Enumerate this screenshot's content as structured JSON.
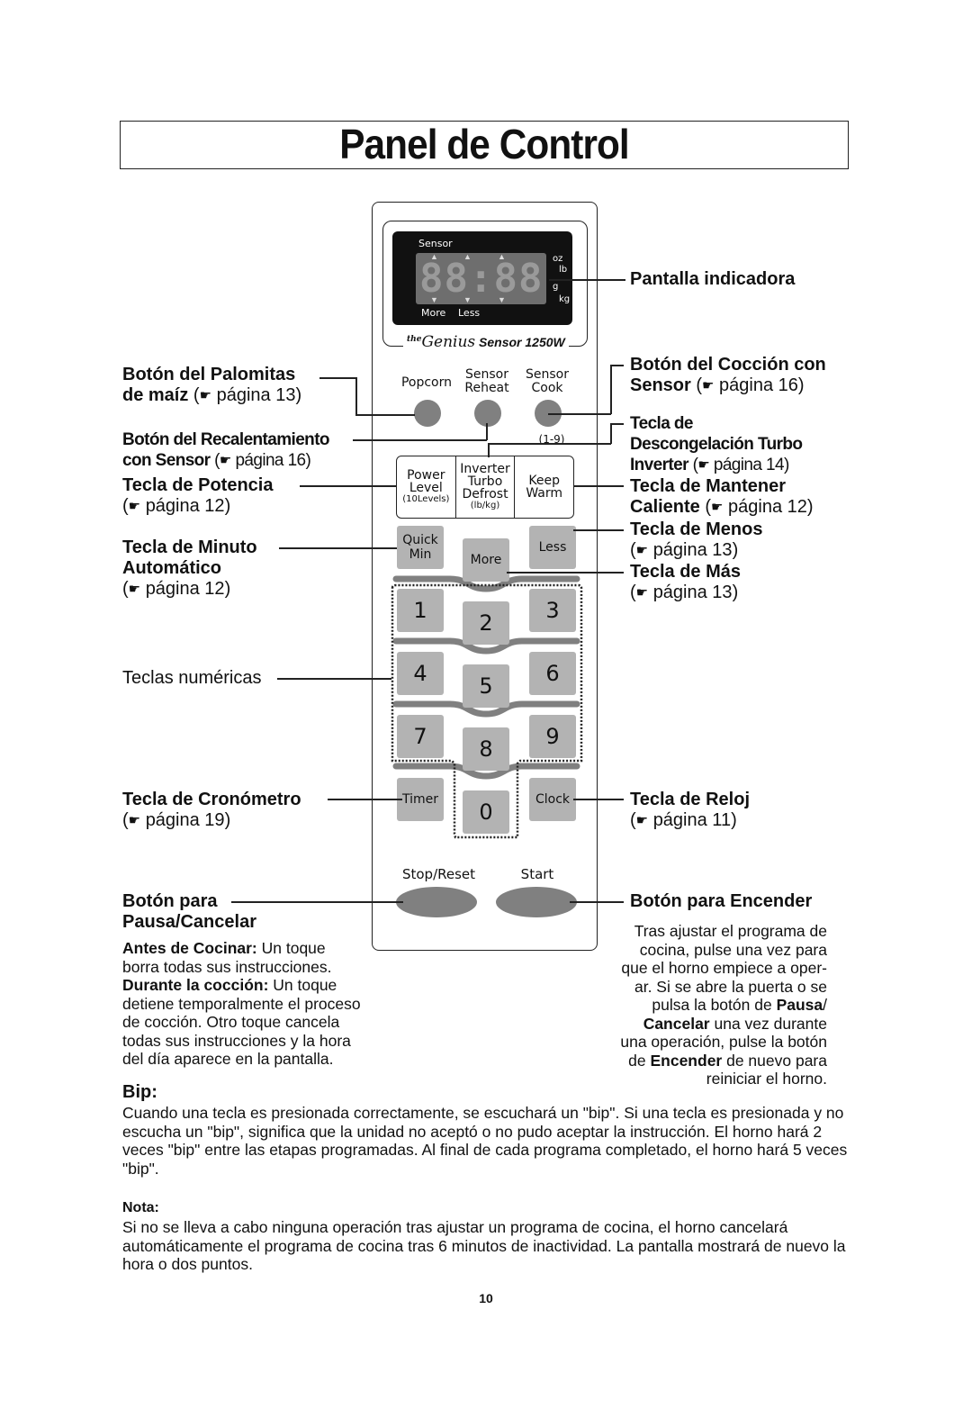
{
  "page": {
    "title": "Panel de Control",
    "page_number": "10",
    "page_ref_icon": "pointing-hand-icon",
    "page_ref_glyph": "☛"
  },
  "panel": {
    "display": {
      "sensor_label": "Sensor",
      "digits": "88:88",
      "more_label": "More",
      "less_label": "Less",
      "unit_oz_lb_top": "oz",
      "unit_oz_lb_bottom": "lb",
      "unit_g_kg_top": "g",
      "unit_g_kg_bottom": "kg"
    },
    "brand": {
      "the": "the",
      "genius": "Genius",
      "model": "Sensor 1250W"
    },
    "top_buttons": [
      {
        "label_line1": "",
        "label_line2": "Popcorn"
      },
      {
        "label_line1": "Sensor",
        "label_line2": "Reheat"
      },
      {
        "label_line1": "Sensor",
        "label_line2": "Cook"
      }
    ],
    "sensor_cook_range": "(1-9)",
    "function_bar": [
      {
        "lines": [
          "Power",
          "Level"
        ],
        "sub": "(10Levels)"
      },
      {
        "lines": [
          "Inverter",
          "Turbo",
          "Defrost"
        ],
        "sub": "(lb/kg)"
      },
      {
        "lines": [
          "Keep",
          "Warm"
        ],
        "sub": ""
      }
    ],
    "quick_min": [
      "Quick",
      "Min"
    ],
    "more": "More",
    "less": "Less",
    "numbers": [
      "1",
      "2",
      "3",
      "4",
      "5",
      "6",
      "7",
      "8",
      "9",
      "0"
    ],
    "timer": "Timer",
    "clock": "Clock",
    "stop_reset": "Stop/Reset",
    "start": "Start",
    "colors": {
      "display_bg": "#111111",
      "display_inner": "#6e6e6e",
      "key_fill": "#b3b3b3",
      "button_fill": "#808080",
      "wave": "#808080"
    }
  },
  "callouts_left": {
    "popcorn": {
      "bold": "Botón del Palomitas",
      "bold2": "de maíz",
      "ref": "página 13"
    },
    "reheat": {
      "bold": "Botón del Recalentamiento",
      "bold2": "con Sensor",
      "ref": "página 16"
    },
    "power": {
      "bold": "Tecla de Potencia",
      "ref": "página 12"
    },
    "quick_min": {
      "bold": "Tecla de Minuto",
      "bold2": "Automático",
      "ref": "página 12"
    },
    "numeric": {
      "text": "Teclas numéricas"
    },
    "timer": {
      "bold": "Tecla de Cronómetro",
      "ref": "página 19"
    },
    "stop": {
      "bold": "Botón para",
      "bold2": "Pausa/Cancelar"
    }
  },
  "callouts_right": {
    "display": {
      "bold": "Pantalla indicadora"
    },
    "sensor_cook": {
      "bold": "Botón del Cocción con",
      "bold2": "Sensor",
      "ref": "página 16"
    },
    "defrost": {
      "bold": "Tecla de",
      "bold2": "Descongelación Turbo",
      "bold3": "Inverter",
      "ref": "página 14"
    },
    "keep_warm": {
      "bold": "Tecla de Mantener",
      "bold2": "Caliente",
      "ref": "página 12"
    },
    "less": {
      "bold": "Tecla de Menos",
      "ref": "página 13"
    },
    "more": {
      "bold": "Tecla de Más",
      "ref": "página 13"
    },
    "clock": {
      "bold": "Tecla de Reloj",
      "ref": "página 11"
    },
    "start": {
      "bold": "Botón para Encender"
    }
  },
  "stop_description": {
    "before_bold": "Antes de Cocinar:",
    "before_text": " Un toque",
    "line2": "borra todas sus instrucciones.",
    "during_bold": "Durante la cocción:",
    "during_text": " Un toque",
    "line4": "detiene temporalmente el proceso",
    "line5": "de cocción. Otro toque cancela",
    "line6": "todas sus instrucciones y la hora",
    "line7": "del día aparece en la pantalla."
  },
  "start_description": {
    "line1": "Tras ajustar el programa de",
    "line2": "cocina, pulse una vez para",
    "line3": "que el horno empiece a oper-",
    "line4": "ar. Si se abre la puerta o se",
    "line5a": "pulsa la botón de ",
    "line5b": "Pausa",
    "line5c": "/",
    "line6a": "Cancelar",
    "line6b": " una vez durante",
    "line7": "una operación, pulse la botón",
    "line8a": "de ",
    "line8b": "Encender",
    "line8c": " de nuevo para",
    "line9": "reiniciar el horno."
  },
  "bip": {
    "heading": "Bip:",
    "text": "Cuando una tecla es presionada correctamente, se escuchará un \"bip\". Si una tecla es presionada y no escucha un \"bip\", significa que la unidad no aceptó o no pudo aceptar la instrucción. El horno hará 2 veces \"bip\" entre las etapas programadas. Al final de cada programa completado, el horno hará 5 veces \"bip\"."
  },
  "nota": {
    "heading": "Nota:",
    "text": "Si no se lleva a cabo ninguna operación tras ajustar un programa de cocina, el horno cancelará automáticamente el programa de cocina tras 6 minutos de inactividad. La pantalla mostrará de nuevo la hora o dos puntos."
  }
}
